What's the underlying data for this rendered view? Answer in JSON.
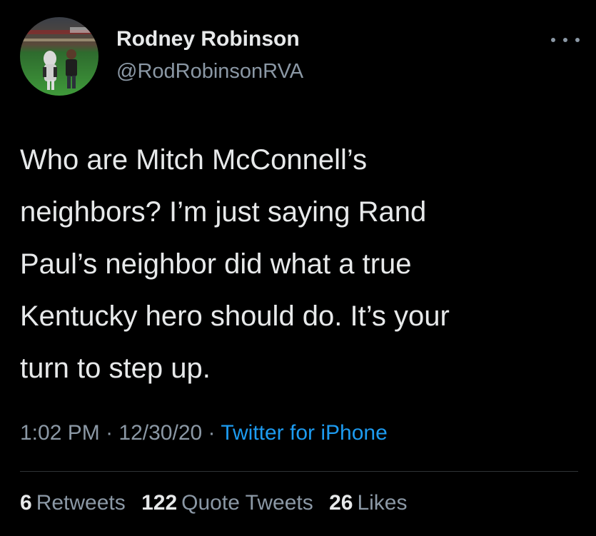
{
  "user": {
    "display_name": "Rodney Robinson",
    "handle": "@RodRobinsonRVA"
  },
  "tweet": {
    "text": "Who are Mitch McConnell’s\nneighbors? I’m just saying Rand\nPaul’s neighbor did what a true\nKentucky hero should do. It’s your\nturn to step up."
  },
  "meta": {
    "time": "1:02 PM",
    "separator1": " · ",
    "date": "12/30/20",
    "separator2": " · ",
    "source": "Twitter for iPhone"
  },
  "stats": {
    "retweets_count": "6",
    "retweets_label": "Retweets",
    "quote_tweets_count": "122",
    "quote_tweets_label": "Quote Tweets",
    "likes_count": "26",
    "likes_label": "Likes"
  },
  "colors": {
    "background": "#000000",
    "primary_text": "#e7e9ea",
    "secondary_text": "#8b98a5",
    "link": "#1d9bf0"
  },
  "icons": {
    "more": "more-horizontal-icon"
  }
}
